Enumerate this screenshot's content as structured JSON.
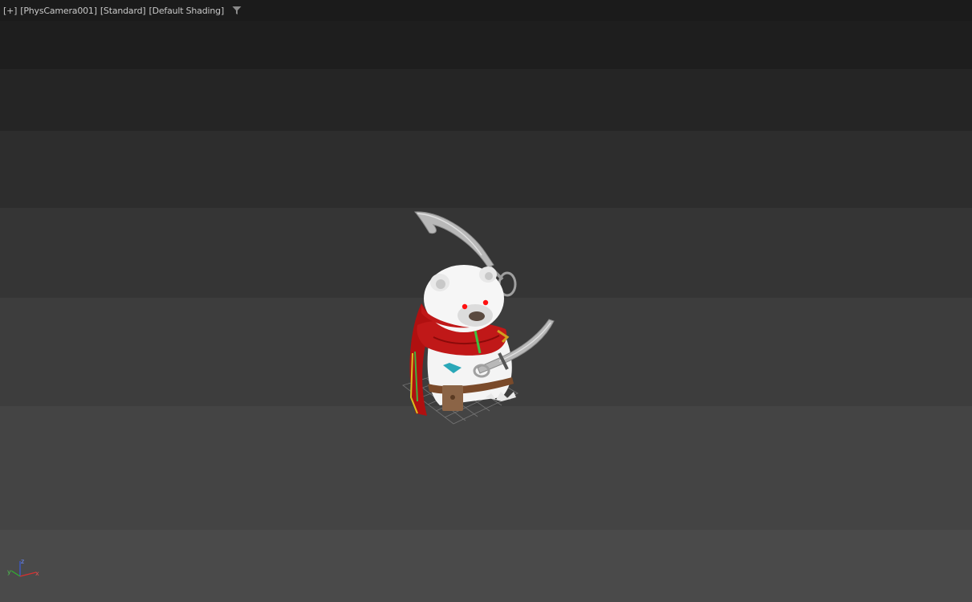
{
  "viewport": {
    "labels": [
      {
        "text": "+"
      },
      {
        "text": "PhysCamera001"
      },
      {
        "text": "Standard"
      },
      {
        "text": "Default Shading"
      }
    ]
  },
  "gizmo": {
    "x_label": "x",
    "y_label": "y",
    "z_label": "z"
  },
  "colors": {
    "header_bg": "#1b1b1b",
    "gradient_bands": [
      "#1e1e1e",
      "#252525",
      "#2d2d2d",
      "#353535",
      "#3d3d3d",
      "#444444",
      "#4a4a4a"
    ]
  }
}
